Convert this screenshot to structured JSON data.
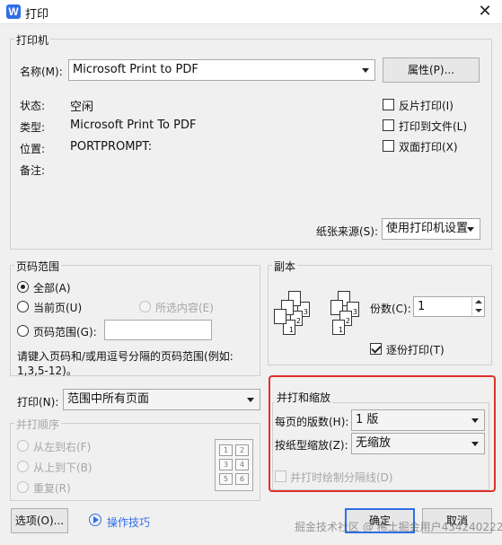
{
  "window": {
    "title": "打印",
    "app_icon": "W"
  },
  "printer": {
    "legend": "打印机",
    "name_label": "名称(M):",
    "name_value": "Microsoft Print to PDF",
    "properties_button": "属性(P)...",
    "status_label": "状态:",
    "status_value": "空闲",
    "type_label": "类型:",
    "type_value": "Microsoft Print To PDF",
    "location_label": "位置:",
    "location_value": "PORTPROMPT:",
    "comment_label": "备注:",
    "reverse_print": "反片打印(I)",
    "print_to_file": "打印到文件(L)",
    "duplex_print": "双面打印(X)",
    "paper_source_label": "纸张来源(S):",
    "paper_source_value": "使用打印机设置"
  },
  "page_range": {
    "legend": "页码范围",
    "all": "全部(A)",
    "current_page": "当前页(U)",
    "selection": "所选内容(E)",
    "pages": "页码范围(G):",
    "pages_value": "",
    "hint_line1": "请键入页码和/或用逗号分隔的页码范围(例如:",
    "hint_line2": "1,3,5-12)。"
  },
  "print_what": {
    "label": "打印(N):",
    "value": "范围中所有页面"
  },
  "collate_order": {
    "legend": "并打顺序",
    "left_to_right": "从左到右(F)",
    "top_to_bottom": "从上到下(B)",
    "repeat": "重复(R)",
    "preview_cells": [
      "1",
      "2",
      "3",
      "4",
      "5",
      "6"
    ]
  },
  "copies": {
    "legend": "副本",
    "count_label": "份数(C):",
    "count_value": "1",
    "collate": "逐份打印(T)",
    "page_numbers": [
      "1",
      "2",
      "3"
    ]
  },
  "zoom": {
    "legend": "并打和缩放",
    "pages_per_sheet_label": "每页的版数(H):",
    "pages_per_sheet_value": "1 版",
    "scale_label": "按纸型缩放(Z):",
    "scale_value": "无缩放",
    "draw_borders": "并打时绘制分隔线(D)"
  },
  "footer": {
    "options_button": "选项(O)...",
    "tips_link": "操作技巧",
    "ok_button": "确定",
    "cancel_button": "取消"
  },
  "watermark": "掘金技术社区 @ 稀土掘金用户434240222559",
  "colors": {
    "highlight_border": "#e0302a",
    "link": "#2f6ee8",
    "app_icon": "#2f6ee8"
  }
}
